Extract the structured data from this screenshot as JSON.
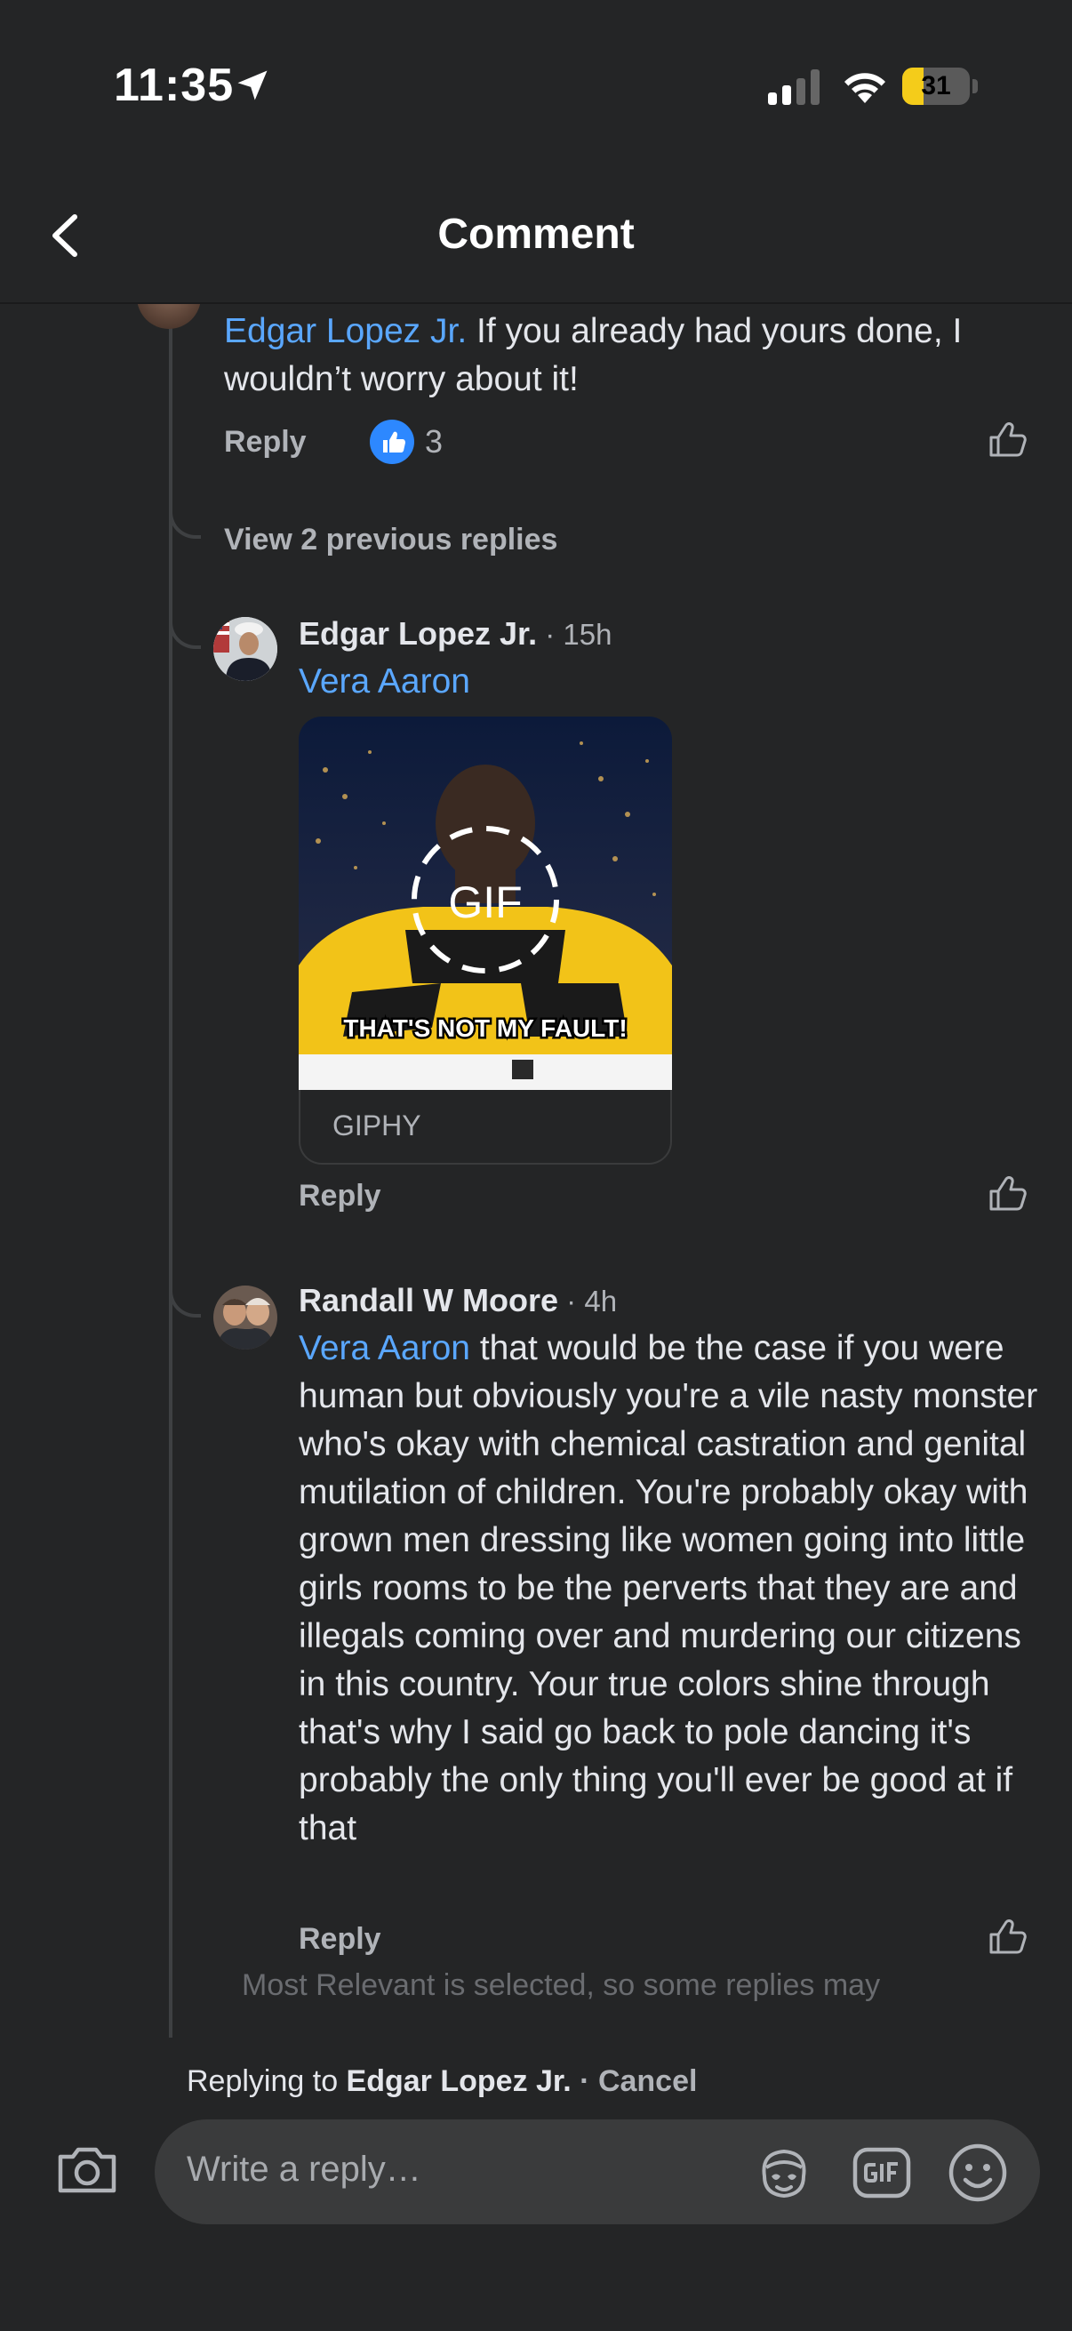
{
  "status": {
    "time": "11:35",
    "battery": "31",
    "battery_level": 0.31
  },
  "header": {
    "title": "Comment"
  },
  "comment1": {
    "mention": "Edgar Lopez Jr.",
    "text": " If you already had yours done, I wouldn’t worry about it!",
    "reply_label": "Reply",
    "reaction_count": "3"
  },
  "view_previous": "View 2 previous replies",
  "comment2": {
    "author": "Edgar Lopez Jr.",
    "time": " · 15h",
    "mention": "Vera Aaron",
    "gif_caption": "THAT'S NOT MY FAULT!",
    "gif_badge": "GIF",
    "gif_source": "GIPHY",
    "reply_label": "Reply"
  },
  "comment3": {
    "author": "Randall W Moore",
    "time": " · 4h",
    "mention": "Vera Aaron",
    "text": " that would be the case if you were human but obviously you're a vile nasty monster who's okay with chemical castration and genital mutilation of children. You're probably okay with grown men dressing like women going into little girls rooms to be the perverts that they are and illegals coming over and murdering our citizens in this country. Your true colors shine through that's why I said go back to pole dancing it's probably the only thing you'll ever be good at if that",
    "reply_label": "Reply"
  },
  "notice": "Most Relevant is selected, so some replies may",
  "composer": {
    "replying_prefix": "Replying to ",
    "replying_name": "Edgar Lopez Jr.",
    "cancel_label": " · Cancel",
    "placeholder": "Write a reply…"
  },
  "icons": {
    "back": "chevron-left-icon",
    "like": "thumbs-up-outline-icon",
    "camera": "camera-icon",
    "sticker": "avatar-sticker-icon",
    "gif": "gif-icon",
    "emoji": "smiley-icon"
  },
  "colors": {
    "background": "#242526",
    "mention": "#5AA7FF",
    "reaction": "#2D88FF",
    "battery": "#F4CC1A"
  }
}
